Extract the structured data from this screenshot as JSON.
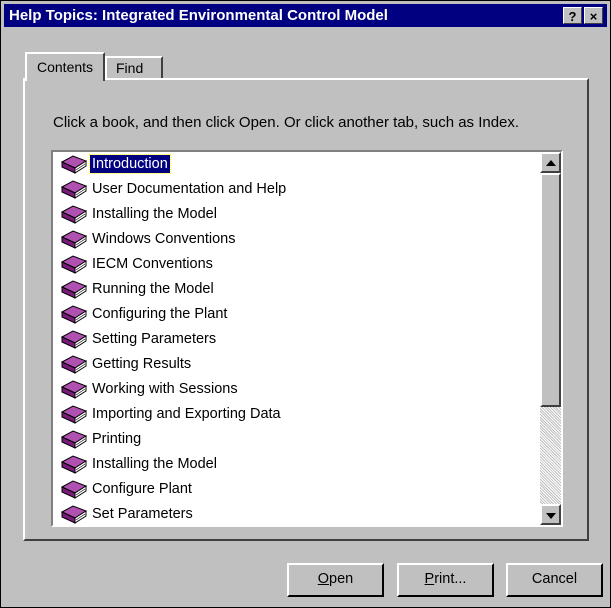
{
  "window": {
    "title": "Help Topics: Integrated Environmental Control Model",
    "help_button": "?",
    "close_button": "×"
  },
  "tabs": [
    {
      "label": "Contents",
      "active": true
    },
    {
      "label": "Find",
      "active": false
    }
  ],
  "instruction": "Click a book, and then click Open. Or click another tab, such as Index.",
  "topics": [
    {
      "label": "Introduction",
      "icon": "book-icon",
      "selected": true
    },
    {
      "label": "User Documentation and Help",
      "icon": "book-icon"
    },
    {
      "label": "Installing the Model",
      "icon": "book-icon"
    },
    {
      "label": "Windows Conventions",
      "icon": "book-icon"
    },
    {
      "label": "IECM Conventions",
      "icon": "book-icon"
    },
    {
      "label": "Running the Model",
      "icon": "book-icon"
    },
    {
      "label": "Configuring the Plant",
      "icon": "book-icon"
    },
    {
      "label": "Setting Parameters",
      "icon": "book-icon"
    },
    {
      "label": "Getting Results",
      "icon": "book-icon"
    },
    {
      "label": "Working with Sessions",
      "icon": "book-icon"
    },
    {
      "label": "Importing and Exporting Data",
      "icon": "book-icon"
    },
    {
      "label": "Printing",
      "icon": "book-icon"
    },
    {
      "label": "Installing the Model",
      "icon": "book-icon"
    },
    {
      "label": "Configure Plant",
      "icon": "book-icon"
    },
    {
      "label": "Set Parameters",
      "icon": "book-icon"
    }
  ],
  "buttons": {
    "open": {
      "mnemonic": "O",
      "rest": "pen"
    },
    "print": {
      "mnemonic": "P",
      "rest": "rint..."
    },
    "cancel": "Cancel"
  },
  "colors": {
    "titlebar": "#000080",
    "face": "#c0c0c0",
    "book": "#7a1a7a"
  }
}
